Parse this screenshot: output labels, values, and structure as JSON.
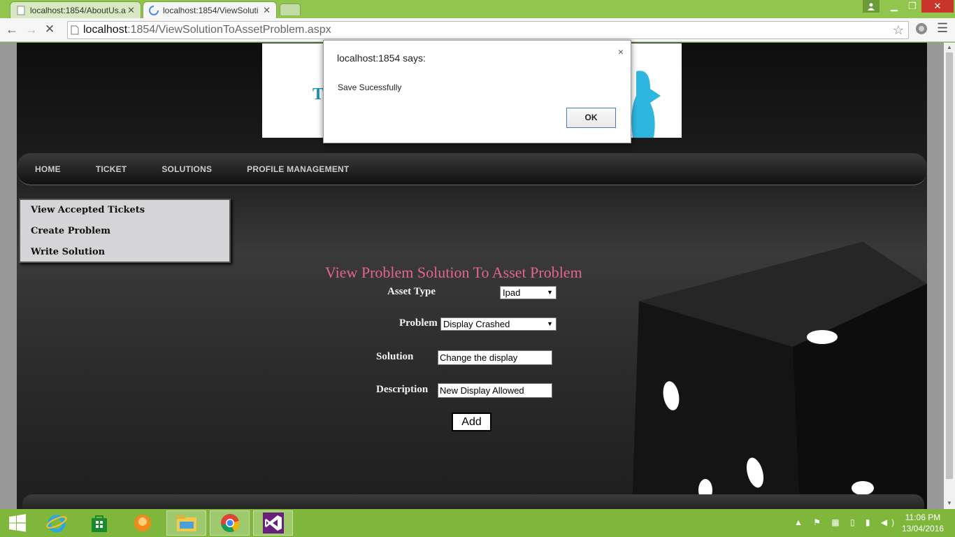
{
  "browser": {
    "tabs": [
      {
        "label": "localhost:1854/AboutUs.a"
      },
      {
        "label": "localhost:1854/ViewSoluti"
      }
    ],
    "url_host": "localhost",
    "url_rest": ":1854/ViewSolutionToAssetProblem.aspx"
  },
  "nav": {
    "items": [
      "HOME",
      "TICKET",
      "SOLUTIONS",
      "PROFILE MANAGEMENT"
    ]
  },
  "submenu": {
    "items": [
      "View Accepted Tickets",
      "Create Problem",
      "Write Solution"
    ]
  },
  "form": {
    "title": "View Problem Solution To Asset Problem",
    "asset_type_label": "Asset Type",
    "asset_type_value": "Ipad",
    "problem_label": "Problem",
    "problem_value": "Display Crashed",
    "solution_label": "Solution",
    "solution_value": "Change the display",
    "description_label": "Description",
    "description_value": "New Display Allowed",
    "add_label": "Add"
  },
  "alert": {
    "title": "localhost:1854 says:",
    "message": "Save Sucessfully",
    "ok_label": "OK",
    "close_label": "×"
  },
  "taskbar": {
    "time": "11:06 PM",
    "date": "13/04/2016"
  },
  "colors": {
    "title_pink": "#e4668a",
    "taskbar_green": "#7eb73c"
  }
}
